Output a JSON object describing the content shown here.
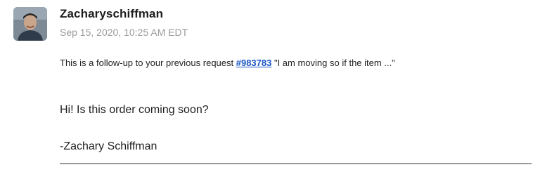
{
  "message": {
    "author": "Zacharyschiffman",
    "timestamp": "Sep 15, 2020, 10:25 AM EDT",
    "followup": {
      "prefix": "This is a follow-up to your previous request ",
      "ticket_link": "#983783",
      "suffix": " \"I am moving so if the item ...\""
    },
    "body": [
      "Hi! Is this order coming soon?",
      "-Zachary Schiffman"
    ]
  },
  "avatar_icon": "user-avatar-photo",
  "colors": {
    "link": "#1a55c4",
    "timestamp": "#9a9a9a",
    "divider": "#9b9b9b"
  }
}
